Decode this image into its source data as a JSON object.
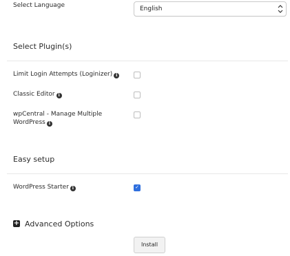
{
  "language": {
    "label": "Select Language",
    "selected": "English"
  },
  "plugins": {
    "heading": "Select Plugin(s)",
    "items": [
      {
        "label": "Limit Login Attempts (Loginizer)",
        "checked": false
      },
      {
        "label": "Classic Editor",
        "checked": false
      },
      {
        "label_line1": "wpCentral - Manage Multiple",
        "label_line2": "WordPress",
        "checked": false
      }
    ]
  },
  "easy_setup": {
    "heading": "Easy setup",
    "items": [
      {
        "label": "WordPress Starter",
        "checked": true
      }
    ]
  },
  "advanced": {
    "label": "Advanced Options"
  },
  "actions": {
    "install_label": "Install"
  },
  "colors": {
    "checkbox_checked": "#2f6fde"
  }
}
